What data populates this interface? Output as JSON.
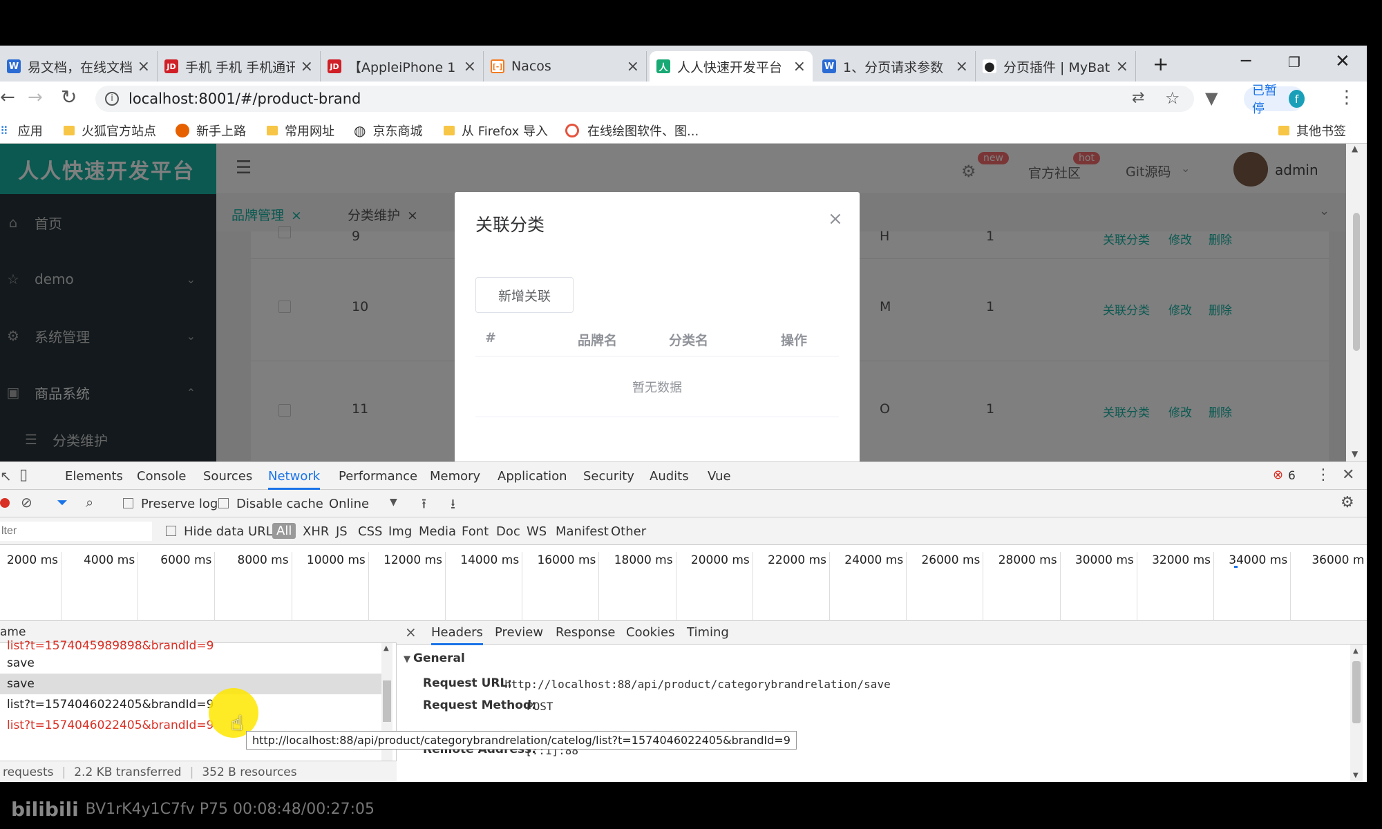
{
  "browser": {
    "tabs": [
      {
        "label": "易文档，在线文档",
        "icon": "W",
        "color": "#2b6cd4"
      },
      {
        "label": "手机 手机 手机通讯",
        "icon": "JD",
        "color": "#d01f26"
      },
      {
        "label": "【AppleiPhone 1",
        "icon": "JD",
        "color": "#d01f26"
      },
      {
        "label": "Nacos",
        "icon": "[-]",
        "color": "#f47b20"
      },
      {
        "label": "人人快速开发平台",
        "icon": "人",
        "color": "#19a974"
      },
      {
        "label": "1、分页请求参数",
        "icon": "W",
        "color": "#2b6cd4"
      },
      {
        "label": "分页插件 | MyBat",
        "icon": "●",
        "color": "#222"
      }
    ],
    "new_tab": "+",
    "address": "localhost:8001/#/product-brand",
    "profile_label": "已暂停",
    "profile_initial": "f",
    "bookmarks": [
      {
        "label": "应用"
      },
      {
        "label": "火狐官方站点"
      },
      {
        "label": "新手上路"
      },
      {
        "label": "常用网址"
      },
      {
        "label": "京东商城"
      },
      {
        "label": "从 Firefox 导入"
      },
      {
        "label": "在线绘图软件、图..."
      }
    ],
    "other_bookmarks": "其他书签"
  },
  "app": {
    "logo": "人人快速开发平台",
    "menu": [
      {
        "label": "首页"
      },
      {
        "label": "demo"
      },
      {
        "label": "系统管理"
      },
      {
        "label": "商品系统"
      },
      {
        "label": "分类维护"
      }
    ],
    "header": {
      "badge_new": "new",
      "community": "官方社区",
      "badge_hot": "hot",
      "git": "Git源码",
      "user": "admin"
    },
    "page_tabs": [
      {
        "label": "品牌管理"
      },
      {
        "label": "分类维护"
      }
    ],
    "rows": [
      {
        "id": "9",
        "letter": "H",
        "sort": "1"
      },
      {
        "id": "10",
        "letter": "M",
        "sort": "1"
      },
      {
        "id": "11",
        "letter": "O",
        "sort": "1"
      }
    ],
    "ops": {
      "relate": "关联分类",
      "edit": "修改",
      "del": "删除"
    }
  },
  "dialog": {
    "title": "关联分类",
    "add_button": "新增关联",
    "columns": [
      "#",
      "品牌名",
      "分类名",
      "操作"
    ],
    "empty": "暂无数据"
  },
  "devtools": {
    "tabs": [
      "Elements",
      "Console",
      "Sources",
      "Network",
      "Performance",
      "Memory",
      "Application",
      "Security",
      "Audits",
      "Vue"
    ],
    "error_count": "6",
    "preserve_log": "Preserve log",
    "disable_cache": "Disable cache",
    "throttle": "Online",
    "filter_placeholder": "lter",
    "hide_data_urls": "Hide data URLs",
    "types": [
      "All",
      "XHR",
      "JS",
      "CSS",
      "Img",
      "Media",
      "Font",
      "Doc",
      "WS",
      "Manifest",
      "Other"
    ],
    "ticks": [
      "2000 ms",
      "4000 ms",
      "6000 ms",
      "8000 ms",
      "10000 ms",
      "12000 ms",
      "14000 ms",
      "16000 ms",
      "18000 ms",
      "20000 ms",
      "22000 ms",
      "24000 ms",
      "26000 ms",
      "28000 ms",
      "30000 ms",
      "32000 ms",
      "34000 ms",
      "36000 m"
    ],
    "name_header": "ame",
    "requests": [
      {
        "name": "list?t=1574045989898&brandId=9",
        "error": true
      },
      {
        "name": "save",
        "error": false
      },
      {
        "name": "save",
        "error": false
      },
      {
        "name": "list?t=1574046022405&brandId=9",
        "error": false
      },
      {
        "name": "list?t=1574046022405&brandId=9",
        "error": true
      }
    ],
    "summary": {
      "requests": "requests",
      "transferred": "2.2 KB transferred",
      "resources": "352 B resources"
    },
    "detail_tabs": [
      "Headers",
      "Preview",
      "Response",
      "Cookies",
      "Timing"
    ],
    "general": "General",
    "request_url_label": "Request URL:",
    "request_url": "http://localhost:88/api/product/categorybrandrelation/save",
    "method_label": "Request Method:",
    "method": "POST",
    "remote_label": "Remote Address:",
    "remote": "[::1]:88",
    "tooltip": "http://localhost:88/api/product/categorybrandrelation/catelog/list?t=1574046022405&brandId=9"
  },
  "watermark": "BV1rK4y1C7fv P75 00:08:48/00:27:05",
  "watermark_logo": "bilibili"
}
